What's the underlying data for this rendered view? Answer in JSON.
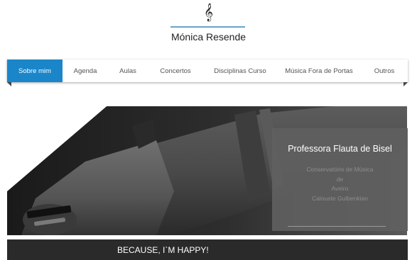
{
  "header": {
    "logo_glyph": "𝄞",
    "title": "Mónica Resende"
  },
  "nav": {
    "items": [
      {
        "label": "Sobre mim",
        "active": true
      },
      {
        "label": "Agenda",
        "active": false
      },
      {
        "label": "Aulas",
        "active": false
      },
      {
        "label": "Concertos",
        "active": false
      },
      {
        "label": "Disciplinas Curso",
        "active": false
      },
      {
        "label": "Música Fora de Portas",
        "active": false
      },
      {
        "label": "Outros",
        "active": false
      }
    ]
  },
  "hero": {
    "image": "recorder-flute-closeup",
    "info_title": "Professora Flauta de Bisel",
    "info_lines": [
      "Conservatório de Música",
      "de",
      "Aveiro",
      "Calouste Gulbenkian"
    ]
  },
  "footer_banner": {
    "text": "BECAUSE, I`M HAPPY!"
  },
  "colors": {
    "accent": "#1a86c9",
    "title_rule": "#6aa3c8",
    "info_box": "#5f5f5f",
    "bottom_bar": "#2a2a2a"
  }
}
